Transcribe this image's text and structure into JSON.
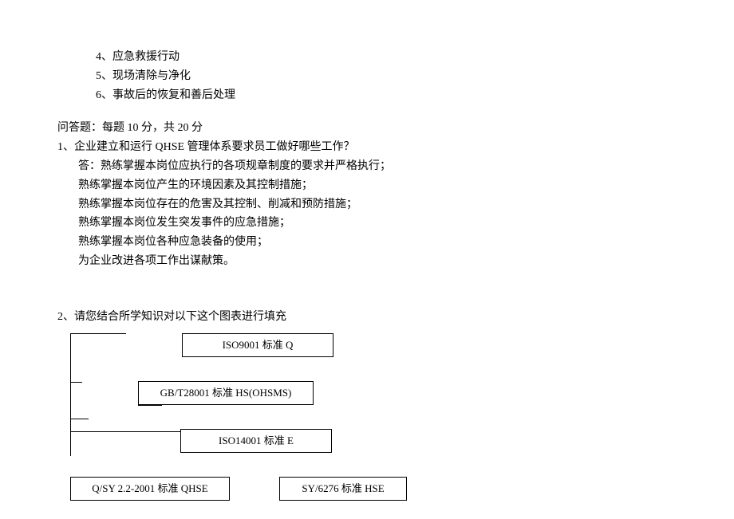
{
  "list": {
    "item4": "4、应急救援行动",
    "item5": "5、现场清除与净化",
    "item6": "6、事故后的恢复和善后处理"
  },
  "essay": {
    "header": "问答题：每题 10 分，共 20 分",
    "q1": {
      "title": "1、企业建立和运行 QHSE 管理体系要求员工做好哪些工作？",
      "a1": "答：熟练掌握本岗位应执行的各项规章制度的要求并严格执行；",
      "a2": "熟练掌握本岗位产生的环境因素及其控制措施；",
      "a3": "熟练掌握本岗位存在的危害及其控制、削减和预防措施；",
      "a4": "熟练掌握本岗位发生突发事件的应急措施；",
      "a5": "熟练掌握本岗位各种应急装备的使用；",
      "a6": "为企业改进各项工作出谋献策。"
    },
    "q2": {
      "title": "2、请您结合所学知识对以下这个图表进行填充"
    }
  },
  "diagram": {
    "b1": "ISO9001 标准 Q",
    "b2": "GB/T28001 标准 HS(OHSMS)",
    "b3": "ISO14001 标准 E",
    "b4": "Q/SY 2.2-2001 标准 QHSE",
    "b5": "SY/6276 标准 HSE"
  }
}
